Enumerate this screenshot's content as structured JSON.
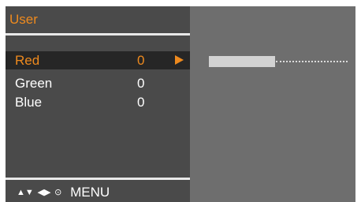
{
  "menu": {
    "title": "User",
    "items": [
      {
        "label": "Red",
        "value": "0",
        "selected": true
      },
      {
        "label": "Green",
        "value": "0",
        "selected": false
      },
      {
        "label": "Blue",
        "value": "0",
        "selected": false
      }
    ]
  },
  "adjust": {
    "slider_level_fraction": 0.48
  },
  "nav_hint": {
    "up_down": "▲▼",
    "left_right": "◀▶",
    "ok": "⊙",
    "menu_label": "MENU"
  },
  "icons": {
    "select_arrow": "select-arrow-icon",
    "up_down": "up-down-arrows-icon",
    "left_right": "left-right-arrows-icon",
    "ok": "ok-button-icon"
  },
  "colors": {
    "accent": "#ee8a1e",
    "panel": "#4a4a4a",
    "screen": "#6e6e6e",
    "highlight": "#262626",
    "text": "#ffffff"
  }
}
